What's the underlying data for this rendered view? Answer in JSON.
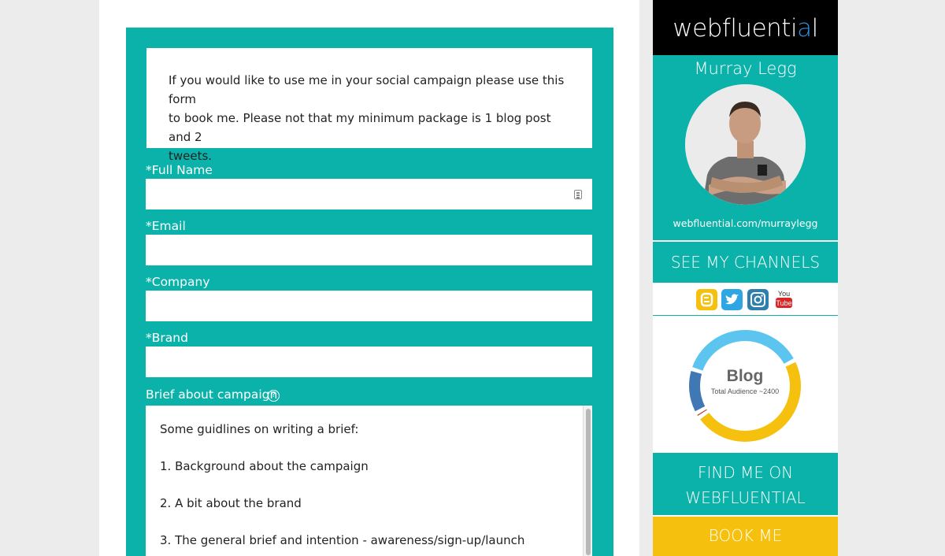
{
  "form": {
    "intro_lines": [
      "If you would like to use me in your social campaign please use this form",
      "to book me. Please not that my minimum package is 1 blog post and 2",
      "tweets."
    ],
    "full_name_label": "*Full Name",
    "full_name_value": "",
    "email_label": "*Email",
    "email_value": "",
    "company_label": "*Company",
    "company_value": "",
    "brand_label": "*Brand",
    "brand_value": "",
    "brief_label": "Brief about campaign",
    "help_glyph": "?",
    "brief_lines": [
      "Some guidlines on writing a brief:",
      "1. Background about the campaign",
      "2. A bit about the brand",
      "3. The general brief and intention - awareness/sign-up/launch"
    ]
  },
  "sidebar": {
    "logo_main": "webfluenti",
    "logo_accent": "a",
    "logo_end": "l",
    "name": "Murray Legg",
    "url": "webfluential.com/murraylegg",
    "channels_button": "SEE MY CHANNELS",
    "channel_icons": [
      {
        "name": "blogger-icon",
        "color": "#f5c10e"
      },
      {
        "name": "twitter-icon",
        "color": "#2fa6e3"
      },
      {
        "name": "instagram-icon",
        "color": "#2f7fae"
      },
      {
        "name": "youtube-icon",
        "color": "#d92626",
        "label_top": "You",
        "label_bottom": "Tube"
      }
    ],
    "donut": {
      "title": "Blog",
      "subtitle": "Total Audience ~2400",
      "segments": [
        {
          "name": "blog",
          "fraction": 0.48,
          "color": "#f5c10e"
        },
        {
          "name": "accent",
          "fraction": 0.015,
          "color": "#c0392b"
        },
        {
          "name": "instagram",
          "fraction": 0.13,
          "color": "#3f78b4"
        },
        {
          "name": "twitter",
          "fraction": 0.375,
          "color": "#5bc4ef"
        }
      ]
    },
    "find_lines": [
      "FIND ME ON",
      "WEBFLUENTIAL"
    ],
    "book_button": "BOOK ME"
  },
  "colors": {
    "teal": "#0bb2a9",
    "yellow": "#f5c10e",
    "logo_accent": "#2d8fe0"
  }
}
